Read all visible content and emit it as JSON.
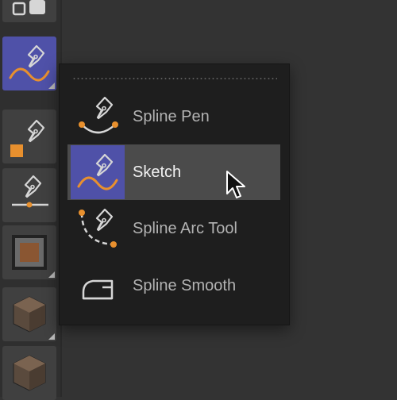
{
  "toolbar": {
    "buttons": [
      {
        "icon": "layout-icon",
        "active": false
      },
      {
        "icon": "sketch-icon",
        "active": true
      },
      {
        "icon": "pen-square-icon",
        "active": false
      },
      {
        "icon": "pen-line-icon",
        "active": false
      },
      {
        "icon": "square-frame-icon",
        "active": false
      },
      {
        "icon": "cube-icon",
        "active": false
      },
      {
        "icon": "cube-icon",
        "active": false
      }
    ]
  },
  "flyout": {
    "items": [
      {
        "label": "Spline Pen",
        "icon": "spline-pen-icon",
        "selected": false
      },
      {
        "label": "Sketch",
        "icon": "sketch-icon",
        "selected": true
      },
      {
        "label": "Spline Arc Tool",
        "icon": "spline-arc-tool-icon",
        "selected": false
      },
      {
        "label": "Spline Smooth",
        "icon": "spline-smooth-icon",
        "selected": false
      }
    ]
  },
  "colors": {
    "accent_orange": "#e8902e",
    "active_blue": "#4f51a8",
    "icon_stroke": "#d6d6d6"
  }
}
